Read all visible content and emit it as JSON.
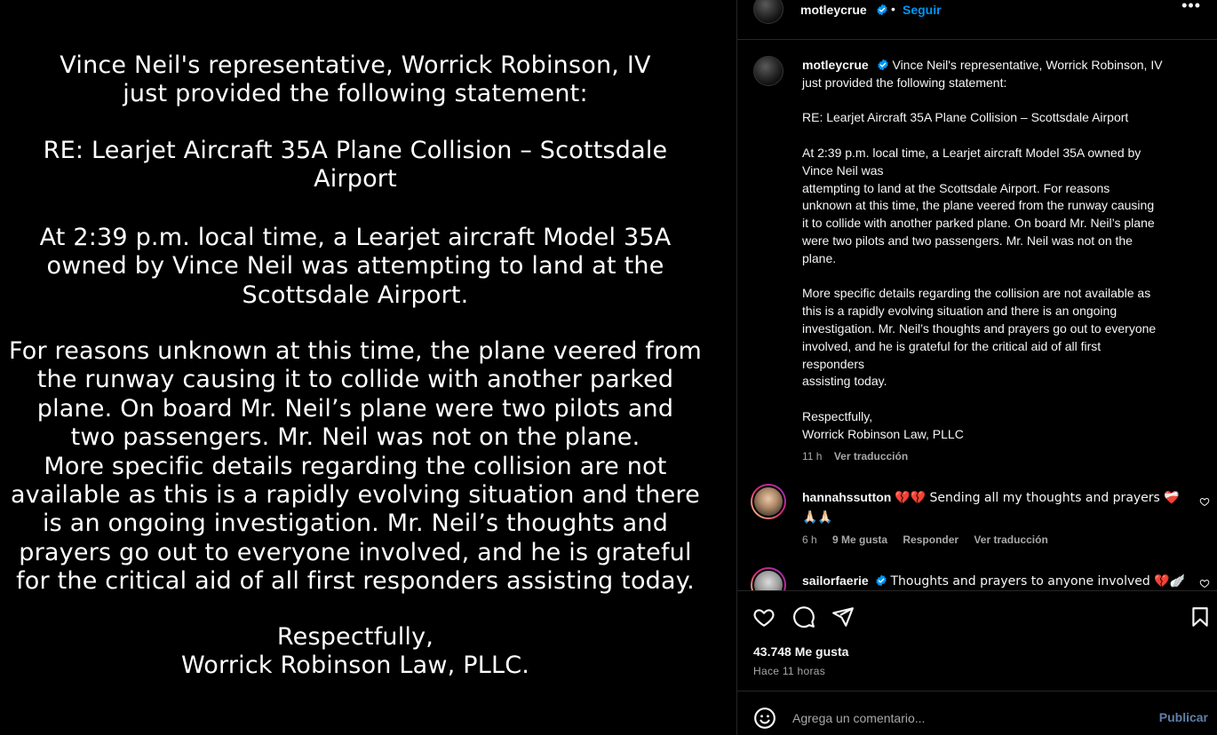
{
  "image_text": {
    "block1": "Vince Neil's representative, Worrick Robinson, IV\njust provided the following statement:",
    "block2": "RE: Learjet Aircraft 35A Plane Collision – Scottsdale\nAirport",
    "block3": "At 2:39 p.m. local time, a Learjet aircraft Model 35A\nowned by Vince Neil was attempting to land at the\nScottsdale Airport.",
    "block4": "For reasons unknown at this time, the plane veered from\nthe runway causing it to collide with another parked\nplane. On board Mr. Neil’s plane were two pilots and\ntwo passengers. Mr. Neil was not on the plane.\nMore specific details regarding the collision are not\navailable as this is a rapidly evolving situation and there\nis an ongoing investigation. Mr. Neil’s thoughts and\nprayers go out to everyone involved, and he is grateful\nfor the critical aid of all first responders assisting today.",
    "block5": "Respectfully,\nWorrick Robinson Law, PLLC."
  },
  "header": {
    "username": "motleycrue",
    "separator": "•",
    "follow_label": "Seguir",
    "more_label": "•••"
  },
  "caption": {
    "username": "motleycrue",
    "lines": [
      "Vince Neil's representative, Worrick Robinson, IV",
      "just provided the following statement:",
      "",
      "RE: Learjet Aircraft 35A Plane Collision – Scottsdale Airport",
      "",
      "At 2:39 p.m. local time, a Learjet aircraft Model 35A owned by",
      "Vince Neil was",
      "attempting to land at the Scottsdale Airport. For reasons",
      "unknown at this time, the plane veered from the runway causing",
      "it to collide with another parked plane. On board Mr. Neil’s plane",
      "were two pilots and two passengers. Mr. Neil was not on the",
      "plane.",
      "",
      "More specific details regarding the collision are not available as",
      "this is a rapidly evolving situation and there is an ongoing",
      "investigation. Mr. Neil’s thoughts and prayers go out to everyone",
      "involved, and he is grateful for the critical aid of all first",
      "responders",
      "assisting today.",
      "",
      "Respectfully,",
      "Worrick Robinson Law, PLLC"
    ],
    "time": "11 h",
    "translate_label": "Ver traducción"
  },
  "comments": [
    {
      "username": "hannahssutton",
      "text_line1": "💔💔 Sending all my thoughts and prayers ❤️‍🩹",
      "text_line2": "🙏🏻🙏🏻",
      "time": "6 h",
      "likes": "9 Me gusta",
      "reply_label": "Responder",
      "translate_label": "Ver traducción"
    },
    {
      "username": "sailorfaerie",
      "text": "Thoughts and prayers to anyone involved 💔🪽"
    }
  ],
  "actions": {
    "likes": "43.748 Me gusta",
    "time_ago": "Hace 11 horas"
  },
  "add_comment": {
    "placeholder": "Agrega un comentario...",
    "publish_label": "Publicar"
  },
  "colors": {
    "background": "#000000",
    "text": "#f5f5f5",
    "secondary_text": "#a8a8a8",
    "link_blue": "#0095f6",
    "verified_blue": "#0095f6",
    "border": "#262626"
  }
}
